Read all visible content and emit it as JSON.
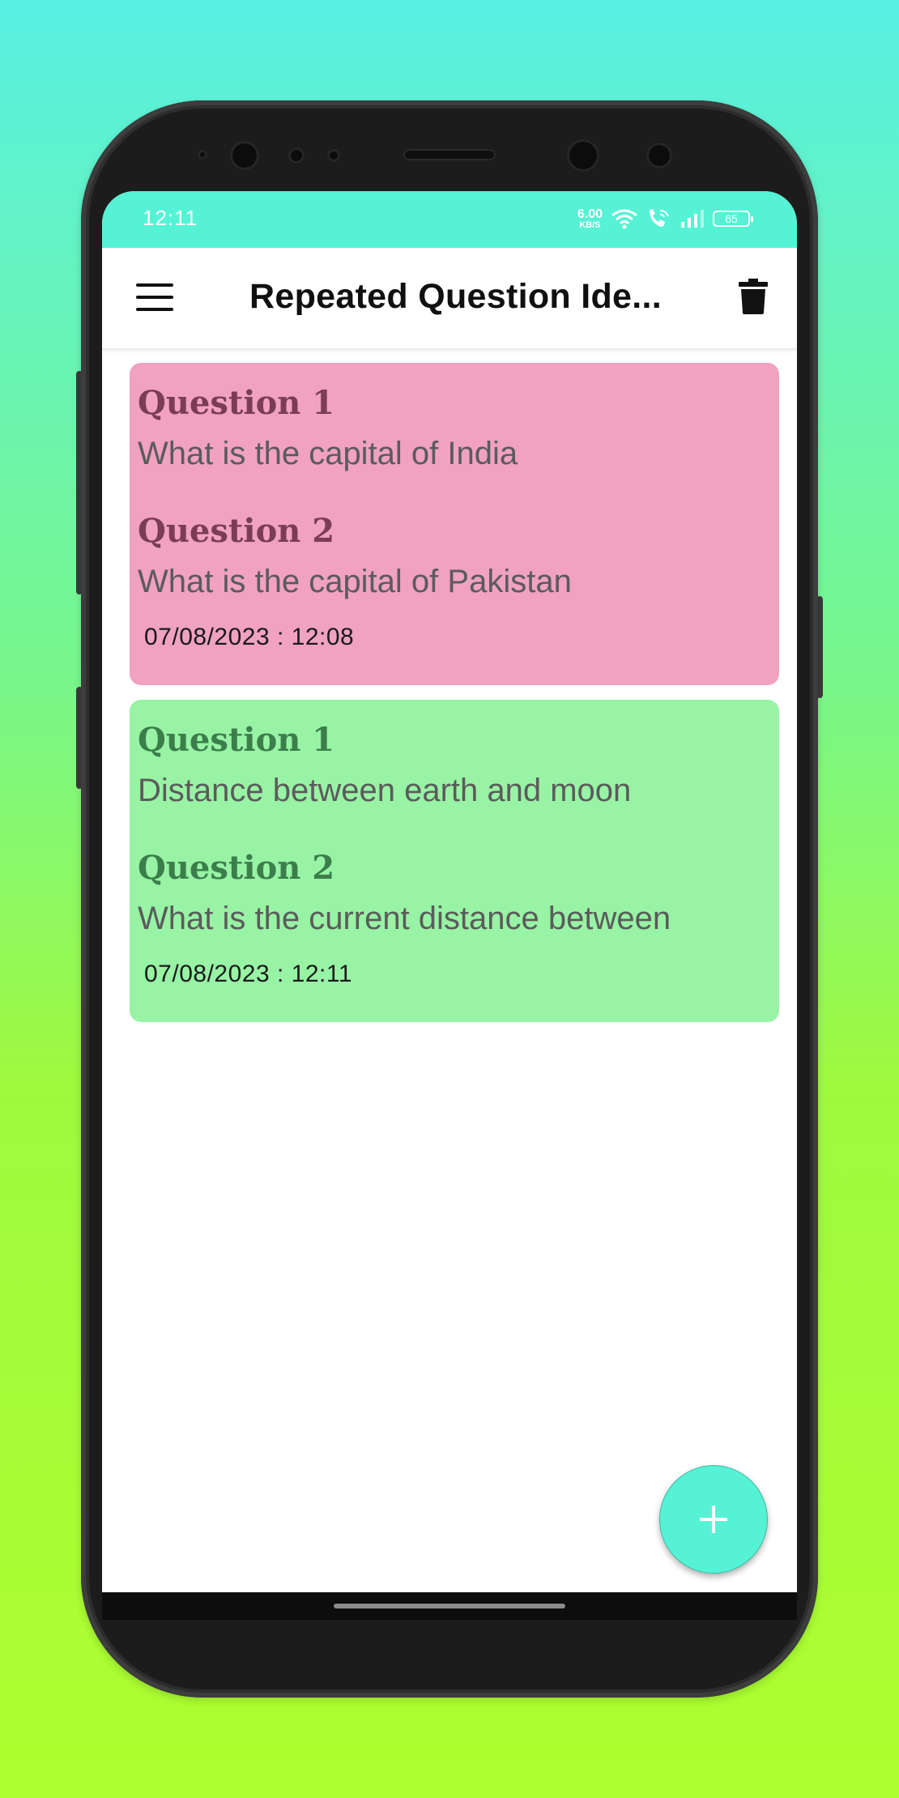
{
  "statusbar": {
    "time": "12:11",
    "net_speed": "6.00",
    "net_speed_unit": "KB/S",
    "battery": "65",
    "icons": [
      "wifi-icon",
      "wifi-call-icon",
      "signal-icon",
      "battery-icon"
    ]
  },
  "appbar": {
    "title": "Repeated Question Ide...",
    "menu_icon": "hamburger-menu-icon",
    "delete_icon": "trash-icon"
  },
  "cards": [
    {
      "q1_label": "Question 1",
      "q1_text": "What is the capital of India",
      "q2_label": "Question 2",
      "q2_text": "What is the capital of Pakistan",
      "date": "07/08/2023 : 12:08",
      "color": "#f0a2c0"
    },
    {
      "q1_label": "Question 1",
      "q1_text": "Distance between earth and moon",
      "q2_label": "Question 2",
      "q2_text": "What is the current distance between",
      "date": "07/08/2023 : 12:11",
      "color": "#98f3a5"
    }
  ],
  "fab": {
    "icon": "plus-icon"
  },
  "colors": {
    "accent": "#56f2d5"
  }
}
